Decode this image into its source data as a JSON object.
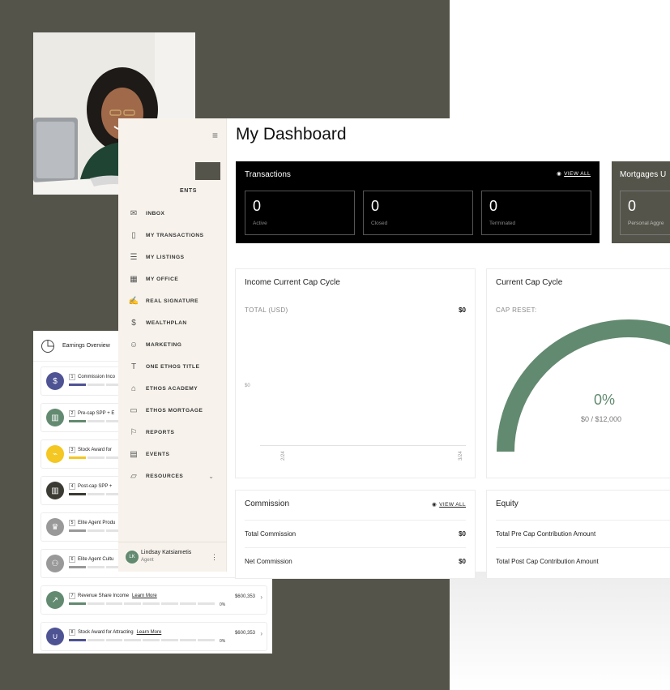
{
  "earnings": {
    "title": "Earnings Overview",
    "rows": [
      {
        "num": "1",
        "label": "Commission Inco",
        "more": "",
        "amount": "",
        "pct": "",
        "icon": "dollar-icon",
        "icon_glyph": "$",
        "color": "#4e5394"
      },
      {
        "num": "2",
        "label": "Pre-cap SPP + E",
        "more": "",
        "amount": "",
        "pct": "",
        "icon": "chart-icon",
        "icon_glyph": "▥",
        "color": "#628a70"
      },
      {
        "num": "3",
        "label": "Stock Award for",
        "more": "",
        "amount": "",
        "pct": "",
        "icon": "pulse-icon",
        "icon_glyph": "⌁",
        "color": "#f4c722"
      },
      {
        "num": "4",
        "label": "Post-cap SPP +",
        "more": "",
        "amount": "",
        "pct": "",
        "icon": "chart-icon",
        "icon_glyph": "▥",
        "color": "#3b3a33"
      },
      {
        "num": "5",
        "label": "Elite Agent Produ",
        "more": "",
        "amount": "",
        "pct": "",
        "icon": "crown-icon",
        "icon_glyph": "♛",
        "color": "#999999"
      },
      {
        "num": "6",
        "label": "Elite Agent Cultu",
        "more": "",
        "amount": "",
        "pct": "",
        "icon": "badge-icon",
        "icon_glyph": "⚇",
        "color": "#999999"
      },
      {
        "num": "7",
        "label": "Revenue Share Income",
        "more": "Learn More",
        "amount": "$600,353",
        "pct": "0%",
        "icon": "trend-icon",
        "icon_glyph": "↗",
        "color": "#628a70"
      },
      {
        "num": "8",
        "label": "Stock Award for Attracting",
        "more": "Learn More",
        "amount": "$600,353",
        "pct": "0%",
        "icon": "magnet-icon",
        "icon_glyph": "∪",
        "color": "#4e5394"
      }
    ]
  },
  "sidebar": {
    "peek_label": "ENTS",
    "items": [
      {
        "label": "INBOX",
        "icon": "inbox-icon",
        "glyph": "✉"
      },
      {
        "label": "MY TRANSACTIONS",
        "icon": "clipboard-icon",
        "glyph": "▯"
      },
      {
        "label": "MY LISTINGS",
        "icon": "list-icon",
        "glyph": "☰"
      },
      {
        "label": "MY OFFICE",
        "icon": "building-icon",
        "glyph": "▦"
      },
      {
        "label": "REAL SIGNATURE",
        "icon": "signature-icon",
        "glyph": "✍"
      },
      {
        "label": "WEALTHPLAN",
        "icon": "dollar-icon",
        "glyph": "$"
      },
      {
        "label": "MARKETING",
        "icon": "people-icon",
        "glyph": "☺"
      },
      {
        "label": "ONE ETHOS TITLE",
        "icon": "title-icon",
        "glyph": "T"
      },
      {
        "label": "ETHOS ACADEMY",
        "icon": "graduation-cap-icon",
        "glyph": "⌂"
      },
      {
        "label": "ETHOS MORTGAGE",
        "icon": "cash-icon",
        "glyph": "▭"
      },
      {
        "label": "REPORTS",
        "icon": "flag-icon",
        "glyph": "⚐"
      },
      {
        "label": "EVENTS",
        "icon": "calendar-icon",
        "glyph": "▤"
      },
      {
        "label": "RESOURCES",
        "icon": "folder-icon",
        "glyph": "▱"
      }
    ],
    "user": {
      "initials": "LK",
      "name": "Lindsay Katsiametis",
      "role": "Agent"
    }
  },
  "main": {
    "title": "My Dashboard",
    "transactions": {
      "title": "Transactions",
      "view_all": "VIEW ALL",
      "boxes": [
        {
          "value": "0",
          "label": "Active"
        },
        {
          "value": "0",
          "label": "Closed"
        },
        {
          "value": "0",
          "label": "Terminated"
        }
      ]
    },
    "mortgages": {
      "title": "Mortgages U",
      "value": "0",
      "label": "Personal Aggre"
    },
    "income": {
      "title": "Income Current Cap Cycle",
      "total_label": "TOTAL (USD)",
      "total_value": "$0",
      "y_zero": "$0",
      "x_ticks": [
        "2/24",
        "3/24"
      ]
    },
    "cap": {
      "title": "Current Cap Cycle",
      "reset_label": "CAP RESET:",
      "percent": "0%",
      "amount": "$0 / $12,000",
      "fill_fraction": 0.78
    },
    "commission": {
      "title": "Commission",
      "view_all": "VIEW ALL",
      "rows": [
        {
          "label": "Total Commission",
          "value": "$0"
        },
        {
          "label": "Net Commission",
          "value": "$0"
        }
      ]
    },
    "equity": {
      "title": "Equity",
      "rows": [
        {
          "label": "Total Pre Cap Contribution Amount",
          "value": ""
        },
        {
          "label": "Total Post Cap Contribution Amount",
          "value": ""
        }
      ]
    }
  }
}
